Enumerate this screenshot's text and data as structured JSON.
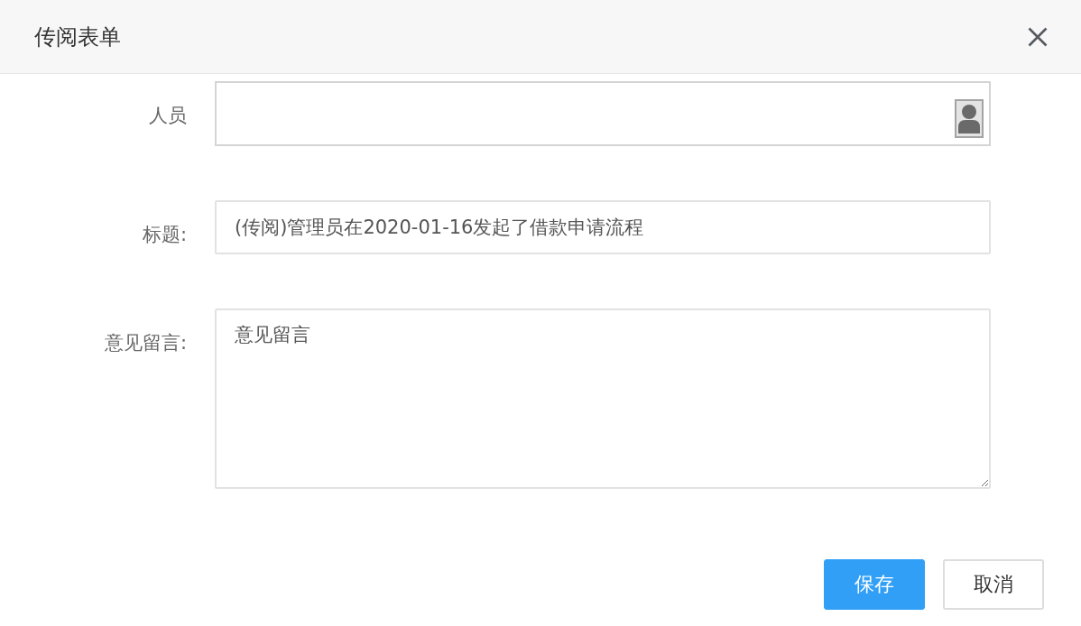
{
  "window": {
    "title": "传阅表单"
  },
  "form": {
    "fields": [
      {
        "kind": "picker",
        "label": "人员"
      },
      {
        "kind": "text",
        "label": "标题:",
        "value": "(传阅)管理员在2020-01-16发起了借款申请流程"
      },
      {
        "kind": "textarea",
        "label": "意见留言:",
        "value": "意见留言"
      }
    ]
  },
  "buttons": [
    {
      "kind": "primary",
      "label": "保存"
    },
    {
      "kind": "default",
      "label": "取消"
    }
  ]
}
